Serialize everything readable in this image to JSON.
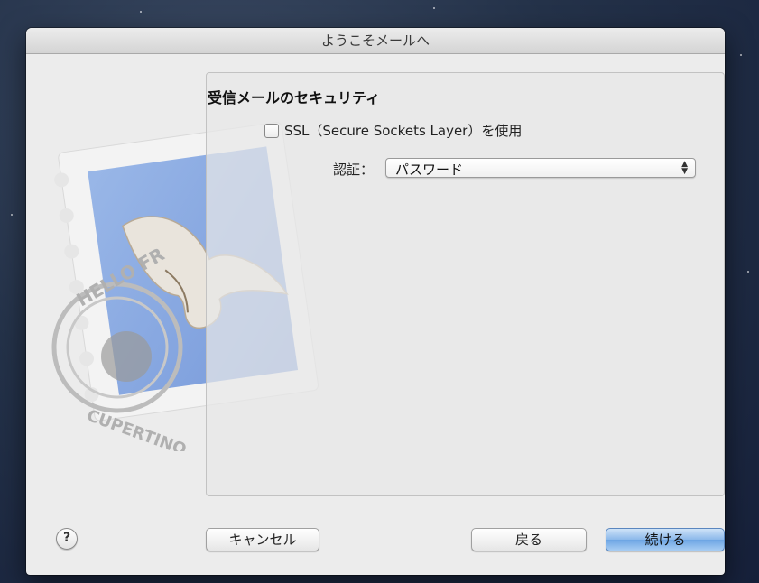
{
  "window": {
    "title": "ようこそメールへ"
  },
  "incoming_security": {
    "title": "受信メールのセキュリティ",
    "ssl_label": "SSL（Secure Sockets Layer）を使用",
    "ssl_checked": false,
    "auth_label": "認証：",
    "auth_value": "パスワード"
  },
  "buttons": {
    "help": "?",
    "cancel": "キャンセル",
    "back": "戻る",
    "continue": "続ける"
  },
  "icons": {
    "stamp": "mail-stamp-icon",
    "select_arrows": "up-down-arrows-icon"
  },
  "colors": {
    "primary_button": "#7fb0e8",
    "window_bg": "#ececec",
    "desktop_bg": "#243249"
  }
}
